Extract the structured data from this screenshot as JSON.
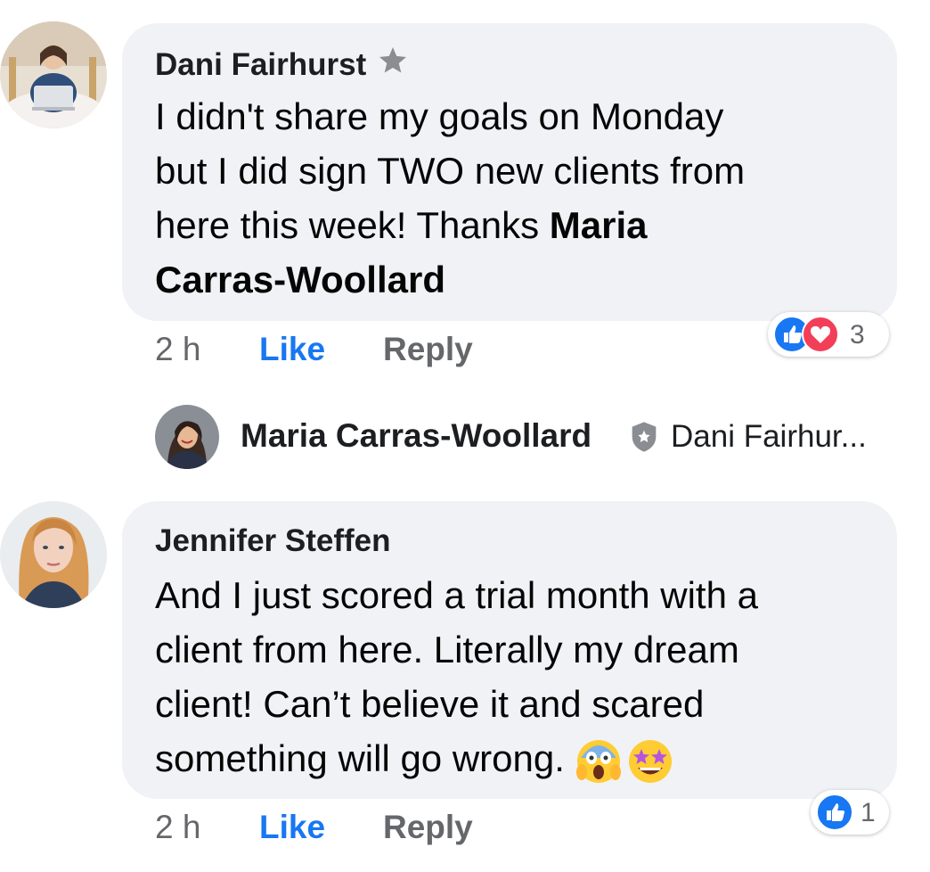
{
  "comments": [
    {
      "author": "Dani Fairhurst",
      "badge": "star-badge",
      "text_lines": [
        "I didn't share my goals on Monday",
        "but I did sign TWO new clients from",
        "here this week! Thanks "
      ],
      "mention_part1": "Maria",
      "mention_part2": "Carras-Woollard",
      "time": "2 h",
      "like": "Like",
      "reply": "Reply",
      "reaction_count": "3"
    },
    {
      "author": "Jennifer Steffen",
      "text_lines": [
        "And I just scored a trial month with a",
        "client from here. Literally my dream",
        "client! Can’t believe it and scared",
        "something will go wrong. "
      ],
      "emojis": [
        "screaming-face-emoji",
        "star-struck-emoji"
      ],
      "time": "2 h",
      "like": "Like",
      "reply": "Reply",
      "reaction_count": "1"
    }
  ],
  "reply_preview": {
    "author": "Maria Carras-Woollard",
    "badge": "admin-shield-badge",
    "snippet": "Dani Fairhur..."
  },
  "colors": {
    "bubble": "#f0f2f5",
    "like_blue": "#1877f2",
    "meta_gray": "#65676b",
    "love_red": "#f33e58"
  }
}
